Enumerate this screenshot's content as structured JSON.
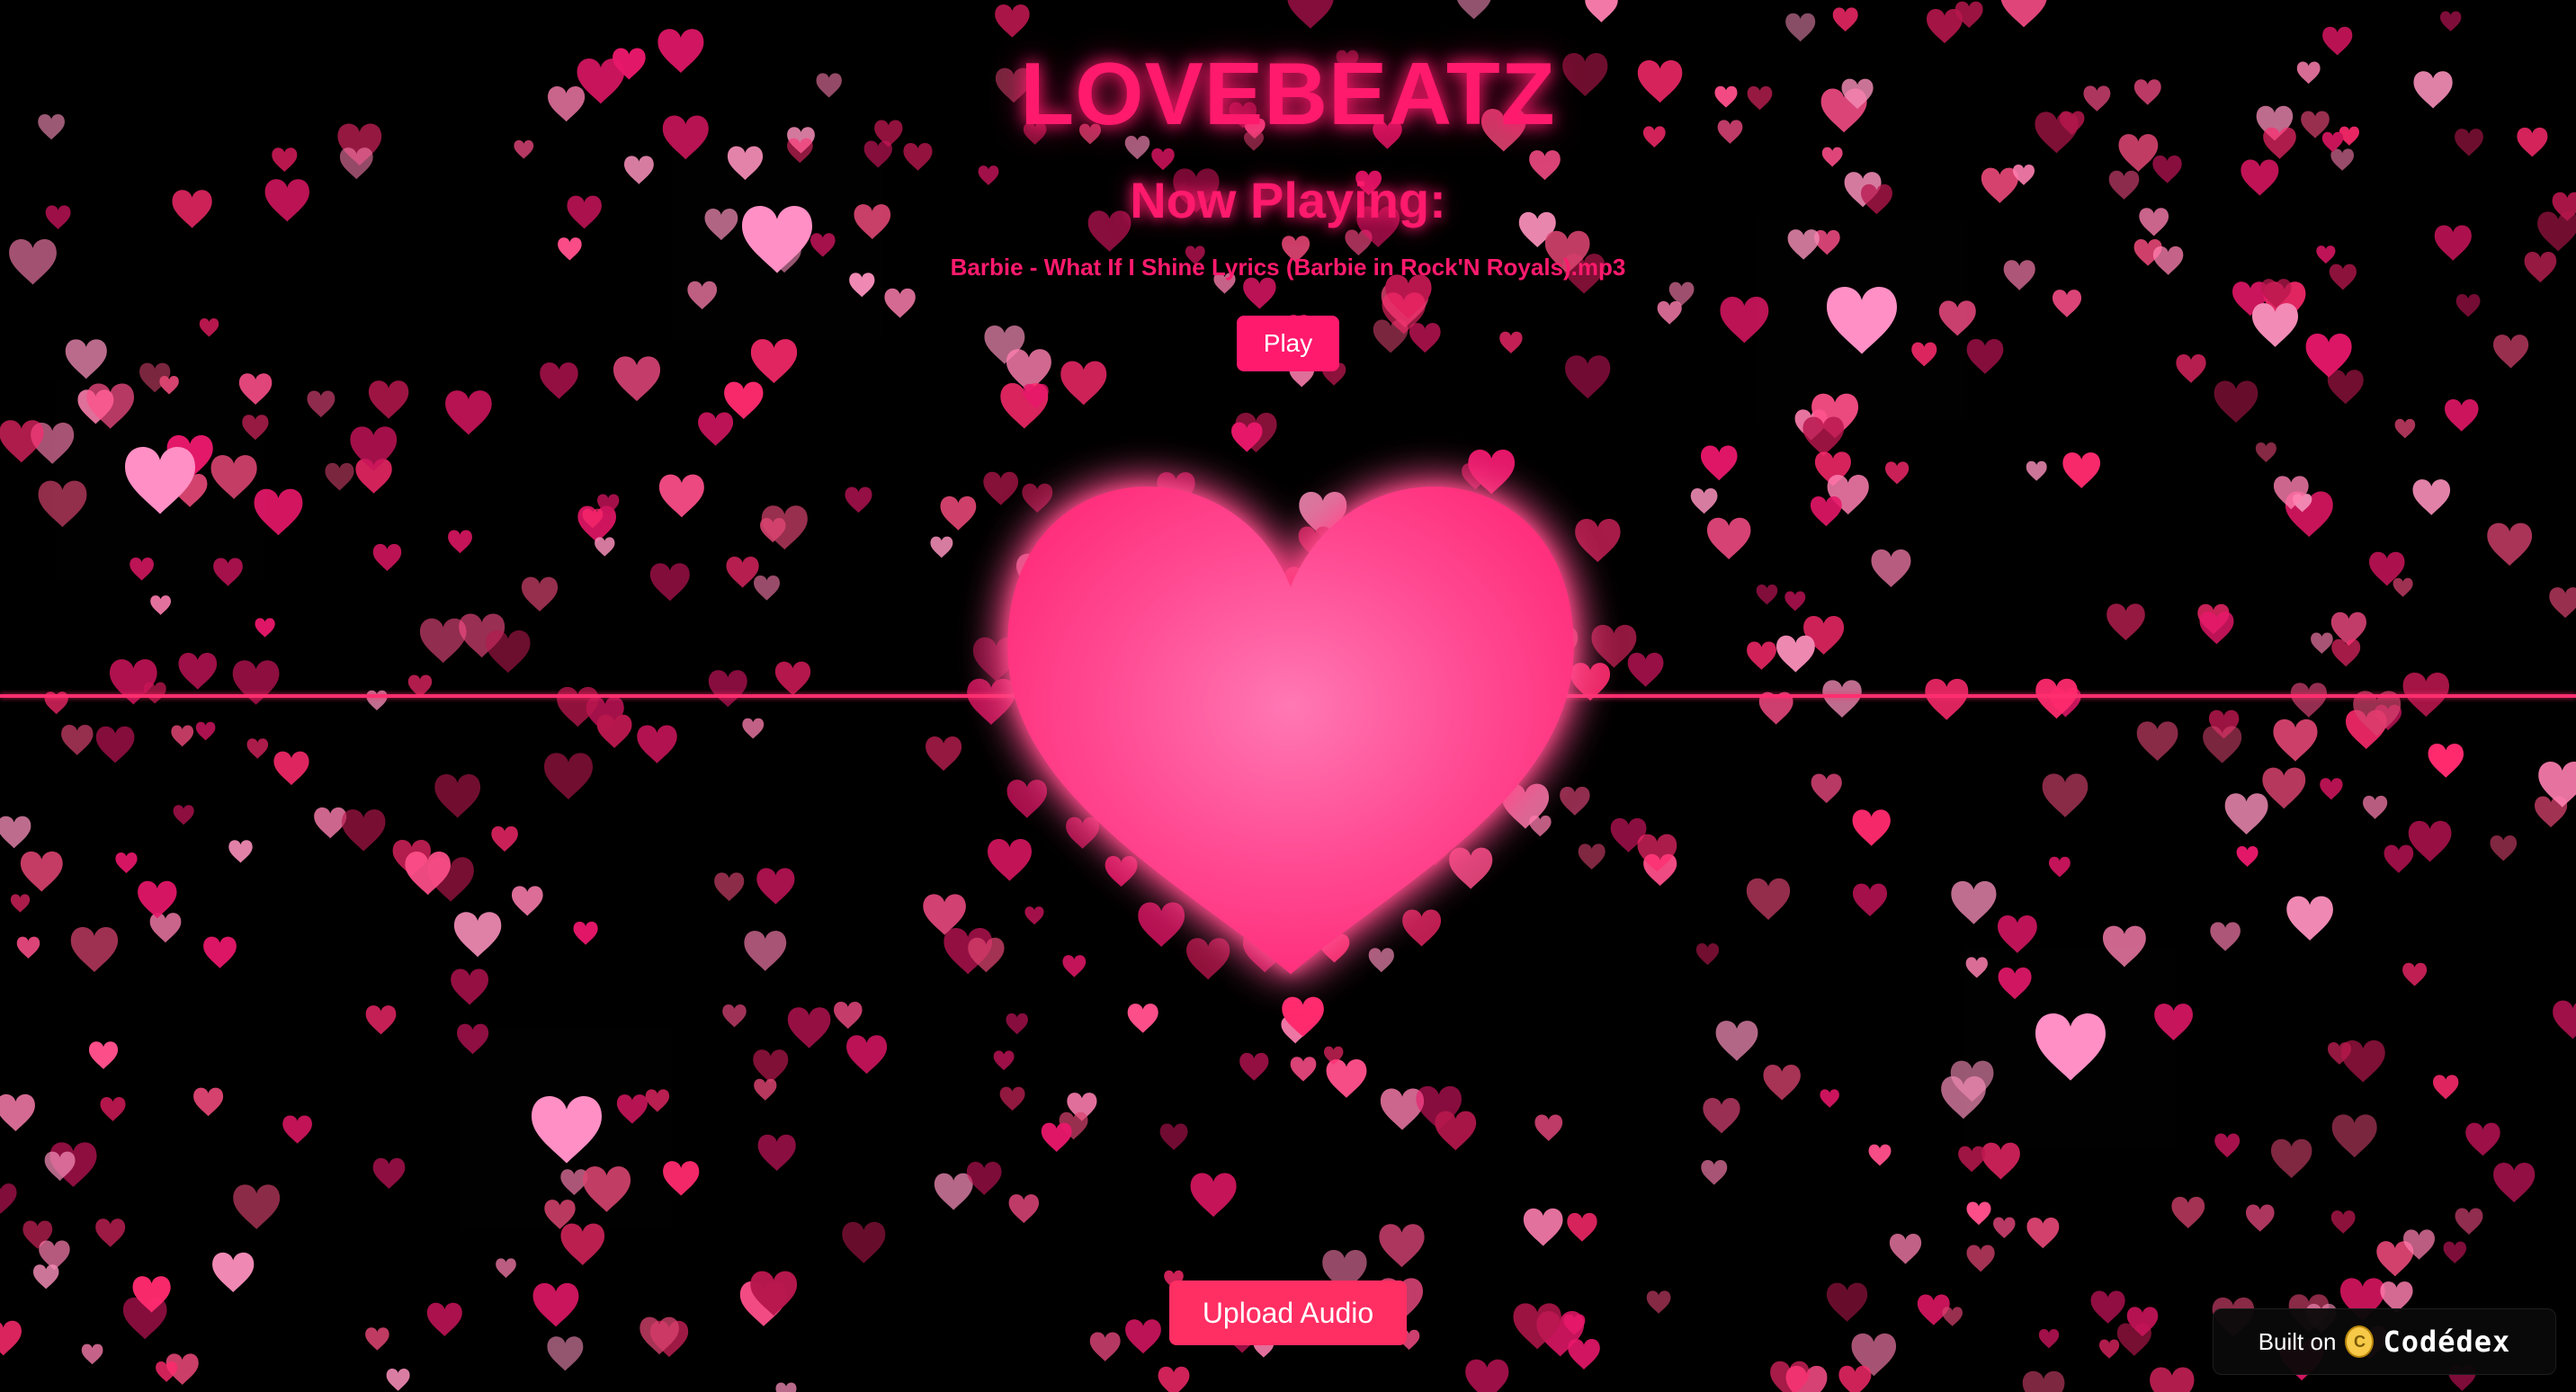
{
  "app": {
    "title": "LOVEBEATZ"
  },
  "player": {
    "now_playing_label": "Now Playing:",
    "track_name": "Barbie - What If I Shine Lyrics (Barbie in Rock'N Royals).mp3",
    "play_label": "Play",
    "upload_label": "Upload Audio"
  },
  "badge": {
    "built_on_label": "Built on",
    "brand_name": "Codédex",
    "coin_glyph": "C"
  },
  "icons": {
    "center": "heart-icon",
    "background": "heart-icon",
    "brand": "codedex-coin-icon"
  },
  "colors": {
    "background": "#000000",
    "accent": "#ff1a6d",
    "button": "#ff1a6d",
    "upload_button": "#ff2e63",
    "waveform": "#ff2e6f",
    "heart_light": "#ff8fc4",
    "heart_dark": "#ff2a78"
  }
}
